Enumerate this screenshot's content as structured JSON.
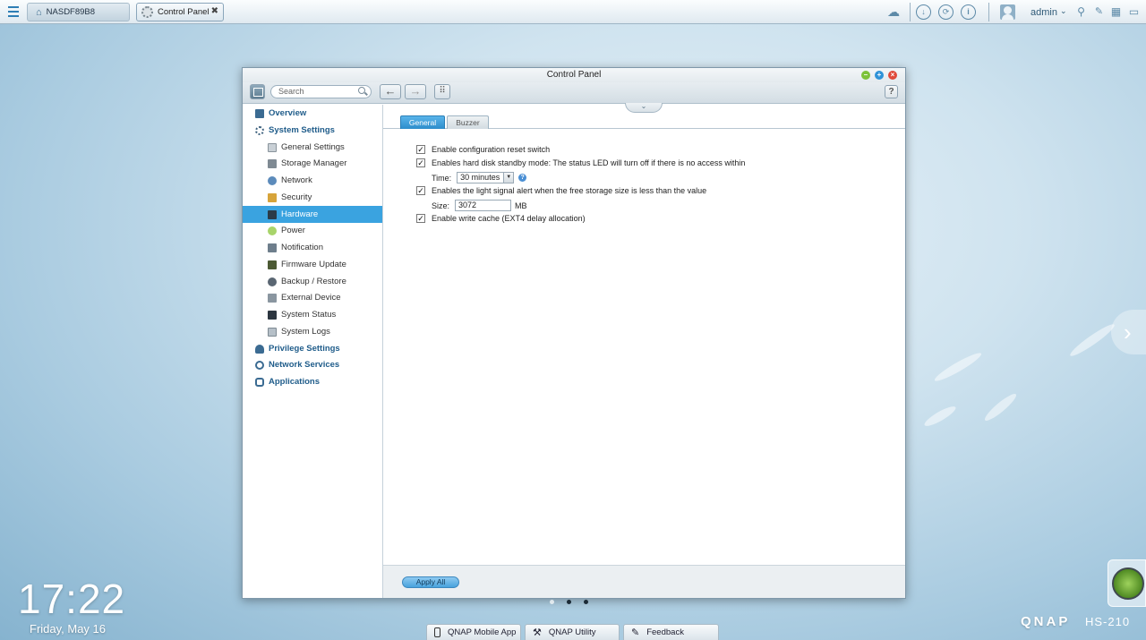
{
  "topbar": {
    "home_label": "NASDF89B8",
    "tab_label": "Control Panel",
    "user": "admin"
  },
  "window": {
    "title": "Control Panel",
    "search_placeholder": "Search"
  },
  "sidebar": {
    "items": [
      {
        "label": "Overview",
        "level": "top"
      },
      {
        "label": "System Settings",
        "level": "top"
      },
      {
        "label": "General Settings",
        "level": "sub"
      },
      {
        "label": "Storage Manager",
        "level": "sub"
      },
      {
        "label": "Network",
        "level": "sub"
      },
      {
        "label": "Security",
        "level": "sub"
      },
      {
        "label": "Hardware",
        "level": "sub",
        "active": true
      },
      {
        "label": "Power",
        "level": "sub"
      },
      {
        "label": "Notification",
        "level": "sub"
      },
      {
        "label": "Firmware Update",
        "level": "sub"
      },
      {
        "label": "Backup / Restore",
        "level": "sub"
      },
      {
        "label": "External Device",
        "level": "sub"
      },
      {
        "label": "System Status",
        "level": "sub"
      },
      {
        "label": "System Logs",
        "level": "sub"
      },
      {
        "label": "Privilege Settings",
        "level": "top"
      },
      {
        "label": "Network Services",
        "level": "top"
      },
      {
        "label": "Applications",
        "level": "top"
      }
    ]
  },
  "main": {
    "tabs": [
      {
        "label": "General",
        "active": true
      },
      {
        "label": "Buzzer",
        "active": false
      }
    ],
    "options": {
      "reset_switch": {
        "label": "Enable configuration reset switch",
        "checked": true
      },
      "standby": {
        "label": "Enables hard disk standby mode: The status LED will turn off if there is no access within",
        "checked": true
      },
      "time_label": "Time:",
      "time_value": "30 minutes",
      "light_alert": {
        "label": "Enables the light signal alert when the free storage size is less than the value",
        "checked": true
      },
      "size_label": "Size:",
      "size_value": "3072",
      "size_unit": "MB",
      "write_cache": {
        "label": "Enable write cache (EXT4 delay allocation)",
        "checked": true
      }
    },
    "apply_label": "Apply All"
  },
  "desktop": {
    "time": "17:22",
    "date": "Friday, May 16",
    "dock": [
      "QNAP Mobile App",
      "QNAP Utility",
      "Feedback"
    ],
    "brand": "QNAP",
    "model": "HS-210"
  },
  "colors": {
    "accent": "#3aa3e0",
    "sidebar_heading": "#1f5c8a",
    "close_button": "#e04a3a",
    "minimize_button": "#7cc23a",
    "maximize_button": "#2f93d8"
  }
}
